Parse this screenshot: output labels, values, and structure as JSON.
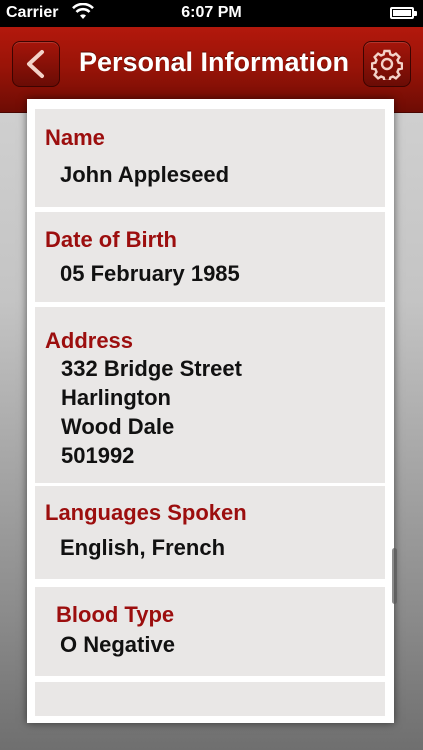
{
  "status_bar": {
    "carrier": "Carrier",
    "time": "6:07 PM"
  },
  "nav": {
    "title": "Personal Information",
    "back_icon": "chevron-left-icon",
    "settings_icon": "gear-icon"
  },
  "fields": [
    {
      "label": "Name",
      "value_lines": [
        "John Appleseed"
      ]
    },
    {
      "label": "Date of Birth",
      "value_lines": [
        "05 February 1985"
      ]
    },
    {
      "label": "Address",
      "value_lines": [
        "332 Bridge Street",
        "Harlington",
        "Wood Dale",
        "501992"
      ]
    },
    {
      "label": "Languages Spoken",
      "value_lines": [
        "English, French"
      ]
    },
    {
      "label": "Blood Type",
      "value_lines": [
        "O Negative"
      ]
    }
  ],
  "colors": {
    "nav_red": "#9a1408",
    "label_red": "#9c0e0e",
    "row_background": "#e9e7e6"
  }
}
